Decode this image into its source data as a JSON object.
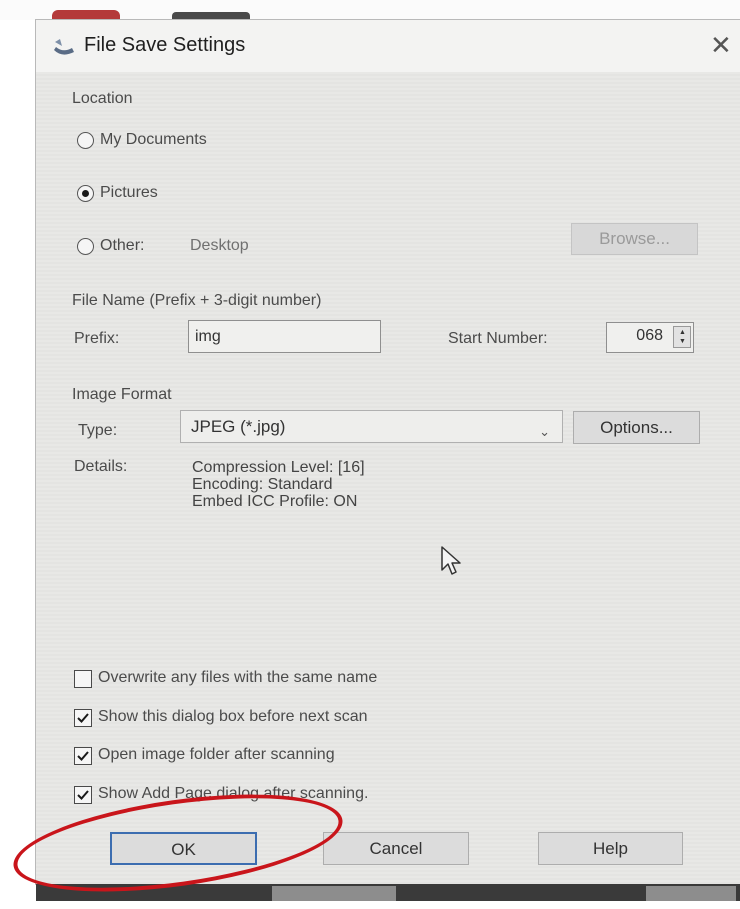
{
  "window": {
    "title": "File Save Settings",
    "close_symbol": "✕"
  },
  "location": {
    "heading": "Location",
    "options": [
      {
        "label": "My Documents",
        "selected": false
      },
      {
        "label": "Pictures",
        "selected": true
      },
      {
        "label": "Other:",
        "selected": false
      }
    ],
    "other_path": "Desktop",
    "browse_label": "Browse..."
  },
  "file_name": {
    "heading": "File Name (Prefix + 3-digit number)",
    "prefix_label": "Prefix:",
    "prefix_value": "img",
    "start_number_label": "Start Number:",
    "start_number_value": "068"
  },
  "image_format": {
    "heading": "Image Format",
    "type_label": "Type:",
    "type_value": "JPEG (*.jpg)",
    "options_label": "Options...",
    "details_label": "Details:",
    "details_lines": [
      "Compression Level: [16]",
      "Encoding: Standard",
      "Embed ICC Profile: ON"
    ]
  },
  "checkboxes": [
    {
      "label": "Overwrite any files with the same name",
      "checked": false
    },
    {
      "label": "Show this dialog box before next scan",
      "checked": true
    },
    {
      "label": "Open image folder after scanning",
      "checked": true
    },
    {
      "label": "Show Add Page dialog after scanning.",
      "checked": true
    }
  ],
  "buttons": {
    "ok": "OK",
    "cancel": "Cancel",
    "help": "Help"
  },
  "colors": {
    "annotation": "#c9151b",
    "dialog_bg": "#e8e8e6",
    "ok_border": "#3c6db0"
  }
}
